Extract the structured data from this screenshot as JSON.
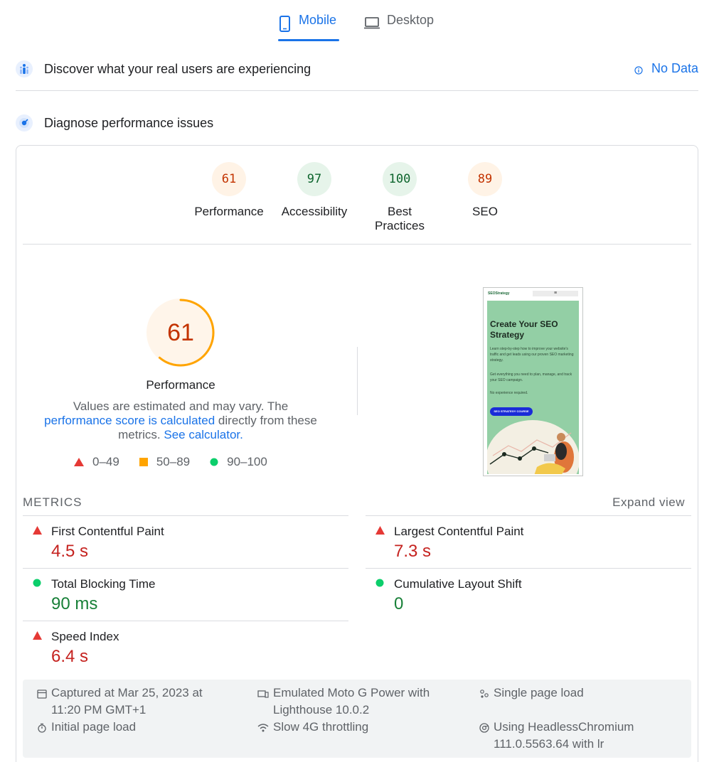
{
  "tabs": {
    "mobile": "Mobile",
    "desktop": "Desktop"
  },
  "field": {
    "title": "Discover what your real users are experiencing",
    "nodata": "No Data"
  },
  "lab": {
    "title": "Diagnose performance issues"
  },
  "categories": [
    {
      "score": "61",
      "label": "Performance",
      "status": "average"
    },
    {
      "score": "97",
      "label": "Accessibility",
      "status": "pass"
    },
    {
      "score": "100",
      "label": "Best Practices",
      "status": "pass"
    },
    {
      "score": "89",
      "label": "SEO",
      "status": "average"
    }
  ],
  "main_gauge": {
    "score": "61",
    "label": "Performance",
    "fraction": 0.61
  },
  "description": {
    "part1": "Values are estimated and may vary. The",
    "link1": "performance score is calculated",
    "part2": "directly from these metrics.",
    "link2": "See calculator."
  },
  "legend": {
    "fail": "0–49",
    "average": "50–89",
    "pass": "90–100"
  },
  "screenshot": {
    "logo": "SEOStrategy",
    "menu": "≡",
    "title": "Create Your SEO Strategy",
    "p1": "Learn step-by-step how to improve your website's traffic and get leads using our proven SEO marketing strategy.",
    "p2": "Get everything you need to plan, manage, and track your SEO campaign.",
    "p3": "No experience required.",
    "button": "SEO STRATEGY COURSE"
  },
  "metrics": {
    "section_label": "METRICS",
    "expand": "Expand view",
    "fcp": {
      "name": "First Contentful Paint",
      "value": "4.5 s",
      "status": "fail"
    },
    "lcp": {
      "name": "Largest Contentful Paint",
      "value": "7.3 s",
      "status": "fail"
    },
    "tbt": {
      "name": "Total Blocking Time",
      "value": "90 ms",
      "status": "pass"
    },
    "cls": {
      "name": "Cumulative Layout Shift",
      "value": "0",
      "status": "pass"
    },
    "si": {
      "name": "Speed Index",
      "value": "6.4 s",
      "status": "fail"
    }
  },
  "runtime": {
    "captured": "Captured at Mar 25, 2023 at 11:20 PM GMT+1",
    "initial": "Initial page load",
    "device": "Emulated Moto G Power with Lighthouse 10.0.2",
    "throttling": "Slow 4G throttling",
    "single": "Single page load",
    "browser": "Using HeadlessChromium 111.0.5563.64 with lr"
  },
  "colors": {
    "accent": "#1a73e8",
    "fail": "#e53935",
    "average": "#ffa400",
    "pass": "#0cce6b"
  },
  "icons": [
    "mobile-icon",
    "desktop-icon",
    "field-data-icon",
    "info-icon",
    "lab-data-icon",
    "triangle-fail-icon",
    "square-average-icon",
    "circle-pass-icon",
    "calendar-icon",
    "stopwatch-icon",
    "device-icon",
    "network-icon",
    "single-load-icon",
    "chrome-icon"
  ]
}
